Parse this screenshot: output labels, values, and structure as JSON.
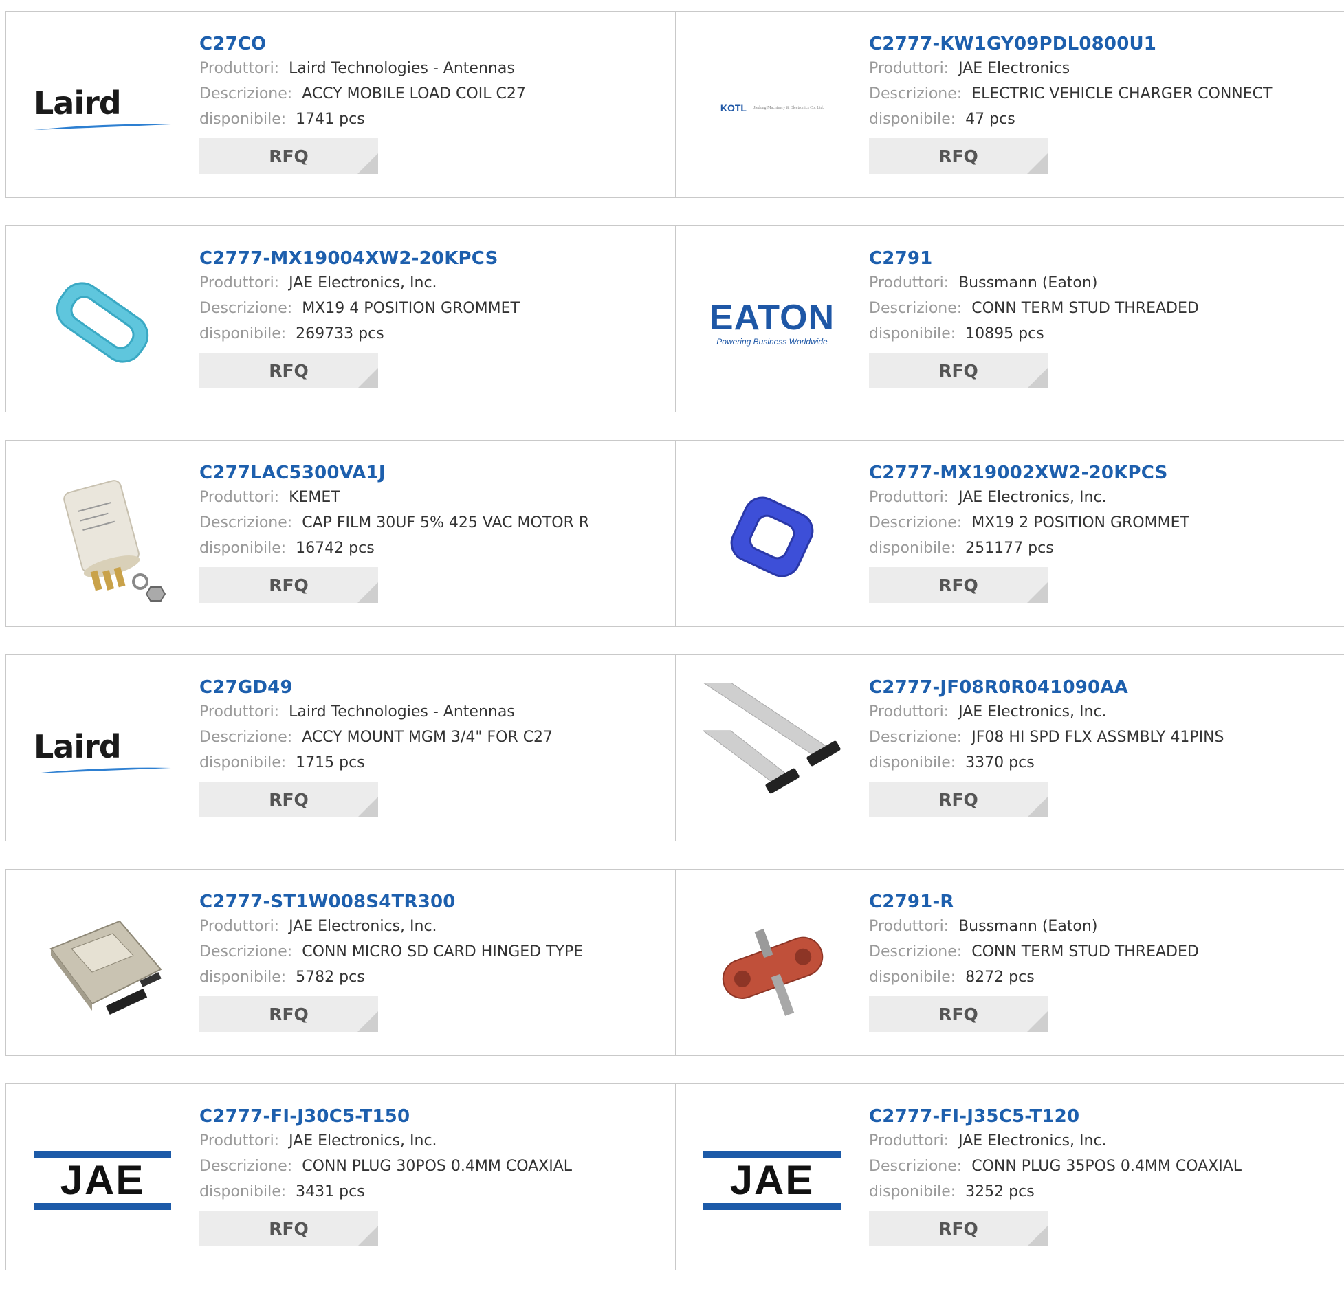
{
  "labels": {
    "manufacturer": "Produttori:",
    "description": "Descrizione:",
    "available": "disponibile:",
    "rfq": "RFQ"
  },
  "logos": {
    "laird": "Laird",
    "jae": "JAE",
    "eaton": "EATON",
    "eaton_tagline": "Powering Business Worldwide",
    "kotl": "KOTL",
    "kotl_sub": "Jiedong Machinery & Electronics Co. Ltd."
  },
  "products": [
    {
      "part": "C27CO",
      "manufacturer": "Laird Technologies - Antennas",
      "description": "ACCY MOBILE LOAD COIL C27",
      "stock": "1741 pcs",
      "image": "laird-logo"
    },
    {
      "part": "C2777-KW1GY09PDL0800U1",
      "manufacturer": "JAE Electronics",
      "description": "ELECTRIC VEHICLE CHARGER CONNECT",
      "stock": "47 pcs",
      "image": "kotl-logo"
    },
    {
      "part": "C2777-MX19004XW2-20KPCS",
      "manufacturer": "JAE Electronics, Inc.",
      "description": "MX19 4 POSITION GROMMET",
      "stock": "269733 pcs",
      "image": "cyan-grommet"
    },
    {
      "part": "C2791",
      "manufacturer": "Bussmann (Eaton)",
      "description": "CONN TERM STUD THREADED",
      "stock": "10895 pcs",
      "image": "eaton-logo"
    },
    {
      "part": "C277LAC5300VA1J",
      "manufacturer": "KEMET",
      "description": "CAP FILM 30UF 5% 425 VAC MOTOR R",
      "stock": "16742 pcs",
      "image": "film-capacitor"
    },
    {
      "part": "C2777-MX19002XW2-20KPCS",
      "manufacturer": "JAE Electronics, Inc.",
      "description": "MX19 2 POSITION GROMMET",
      "stock": "251177 pcs",
      "image": "blue-grommet"
    },
    {
      "part": "C27GD49",
      "manufacturer": "Laird Technologies - Antennas",
      "description": "ACCY MOUNT MGM 3/4\" FOR C27",
      "stock": "1715 pcs",
      "image": "laird-logo"
    },
    {
      "part": "C2777-JF08R0R041090AA",
      "manufacturer": "JAE Electronics, Inc.",
      "description": "JF08 HI SPD FLX ASSMBLY 41PINS",
      "stock": "3370 pcs",
      "image": "flex-cable"
    },
    {
      "part": "C2777-ST1W008S4TR300",
      "manufacturer": "JAE Electronics, Inc.",
      "description": "CONN MICRO SD CARD HINGED TYPE",
      "stock": "5782 pcs",
      "image": "sd-card-connector"
    },
    {
      "part": "C2791-R",
      "manufacturer": "Bussmann (Eaton)",
      "description": "CONN TERM STUD THREADED",
      "stock": "8272 pcs",
      "image": "red-stud"
    },
    {
      "part": "C2777-FI-J30C5-T150",
      "manufacturer": "JAE Electronics, Inc.",
      "description": "CONN PLUG 30POS 0.4MM COAXIAL",
      "stock": "3431 pcs",
      "image": "jae-logo"
    },
    {
      "part": "C2777-FI-J35C5-T120",
      "manufacturer": "JAE Electronics, Inc.",
      "description": "CONN PLUG 35POS 0.4MM COAXIAL",
      "stock": "3252 pcs",
      "image": "jae-logo"
    }
  ]
}
